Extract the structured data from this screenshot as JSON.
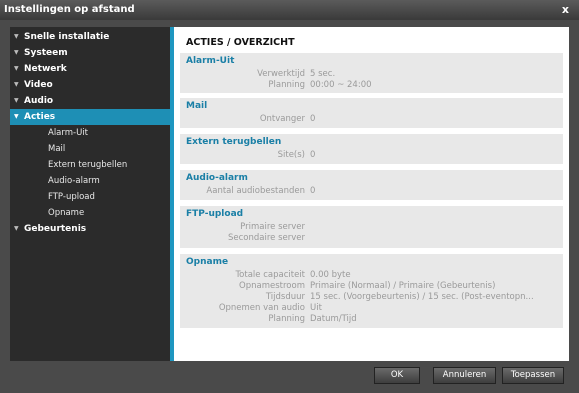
{
  "window": {
    "title": "Instellingen op afstand",
    "close": "x"
  },
  "sidebar": {
    "items": [
      {
        "label": "Snelle installatie"
      },
      {
        "label": "Systeem"
      },
      {
        "label": "Netwerk"
      },
      {
        "label": "Video"
      },
      {
        "label": "Audio"
      },
      {
        "label": "Acties",
        "active": true
      },
      {
        "label": "Gebeurtenis"
      }
    ],
    "sub_items": [
      "Alarm-Uit",
      "Mail",
      "Extern terugbellen",
      "Audio-alarm",
      "FTP-upload",
      "Opname"
    ]
  },
  "main": {
    "title": "ACTIES / OVERZICHT",
    "sections": [
      {
        "title": "Alarm-Uit",
        "rows": [
          {
            "label": "Verwerktijd",
            "value": "5 sec."
          },
          {
            "label": "Planning",
            "value": "00:00 ~ 24:00"
          }
        ]
      },
      {
        "title": "Mail",
        "rows": [
          {
            "label": "Ontvanger",
            "value": "0"
          }
        ]
      },
      {
        "title": "Extern terugbellen",
        "rows": [
          {
            "label": "Site(s)",
            "value": "0"
          }
        ]
      },
      {
        "title": "Audio-alarm",
        "rows": [
          {
            "label": "Aantal audiobestanden",
            "value": "0"
          }
        ]
      },
      {
        "title": "FTP-upload",
        "rows": [
          {
            "label": "Primaire server",
            "value": ""
          },
          {
            "label": "Secondaire server",
            "value": ""
          }
        ]
      },
      {
        "title": "Opname",
        "rows": [
          {
            "label": "Totale capaciteit",
            "value": "0.00 byte"
          },
          {
            "label": "Opnamestroom",
            "value": "Primaire (Normaal) / Primaire (Gebeurtenis)"
          },
          {
            "label": "Tijdsduur",
            "value": "15 sec. (Voorgebeurtenis) / 15 sec. (Post-eventopn..."
          },
          {
            "label": "Opnemen van audio",
            "value": "Uit"
          },
          {
            "label": "Planning",
            "value": "Datum/Tijd"
          }
        ]
      }
    ]
  },
  "footer": {
    "ok": "OK",
    "cancel": "Annuleren",
    "apply": "Toepassen"
  },
  "colors": {
    "accent": "#1e96c0",
    "section_title": "#1a7fa6",
    "sidebar_bg": "#2b2b2b",
    "section_bg": "#e8e8e8"
  }
}
